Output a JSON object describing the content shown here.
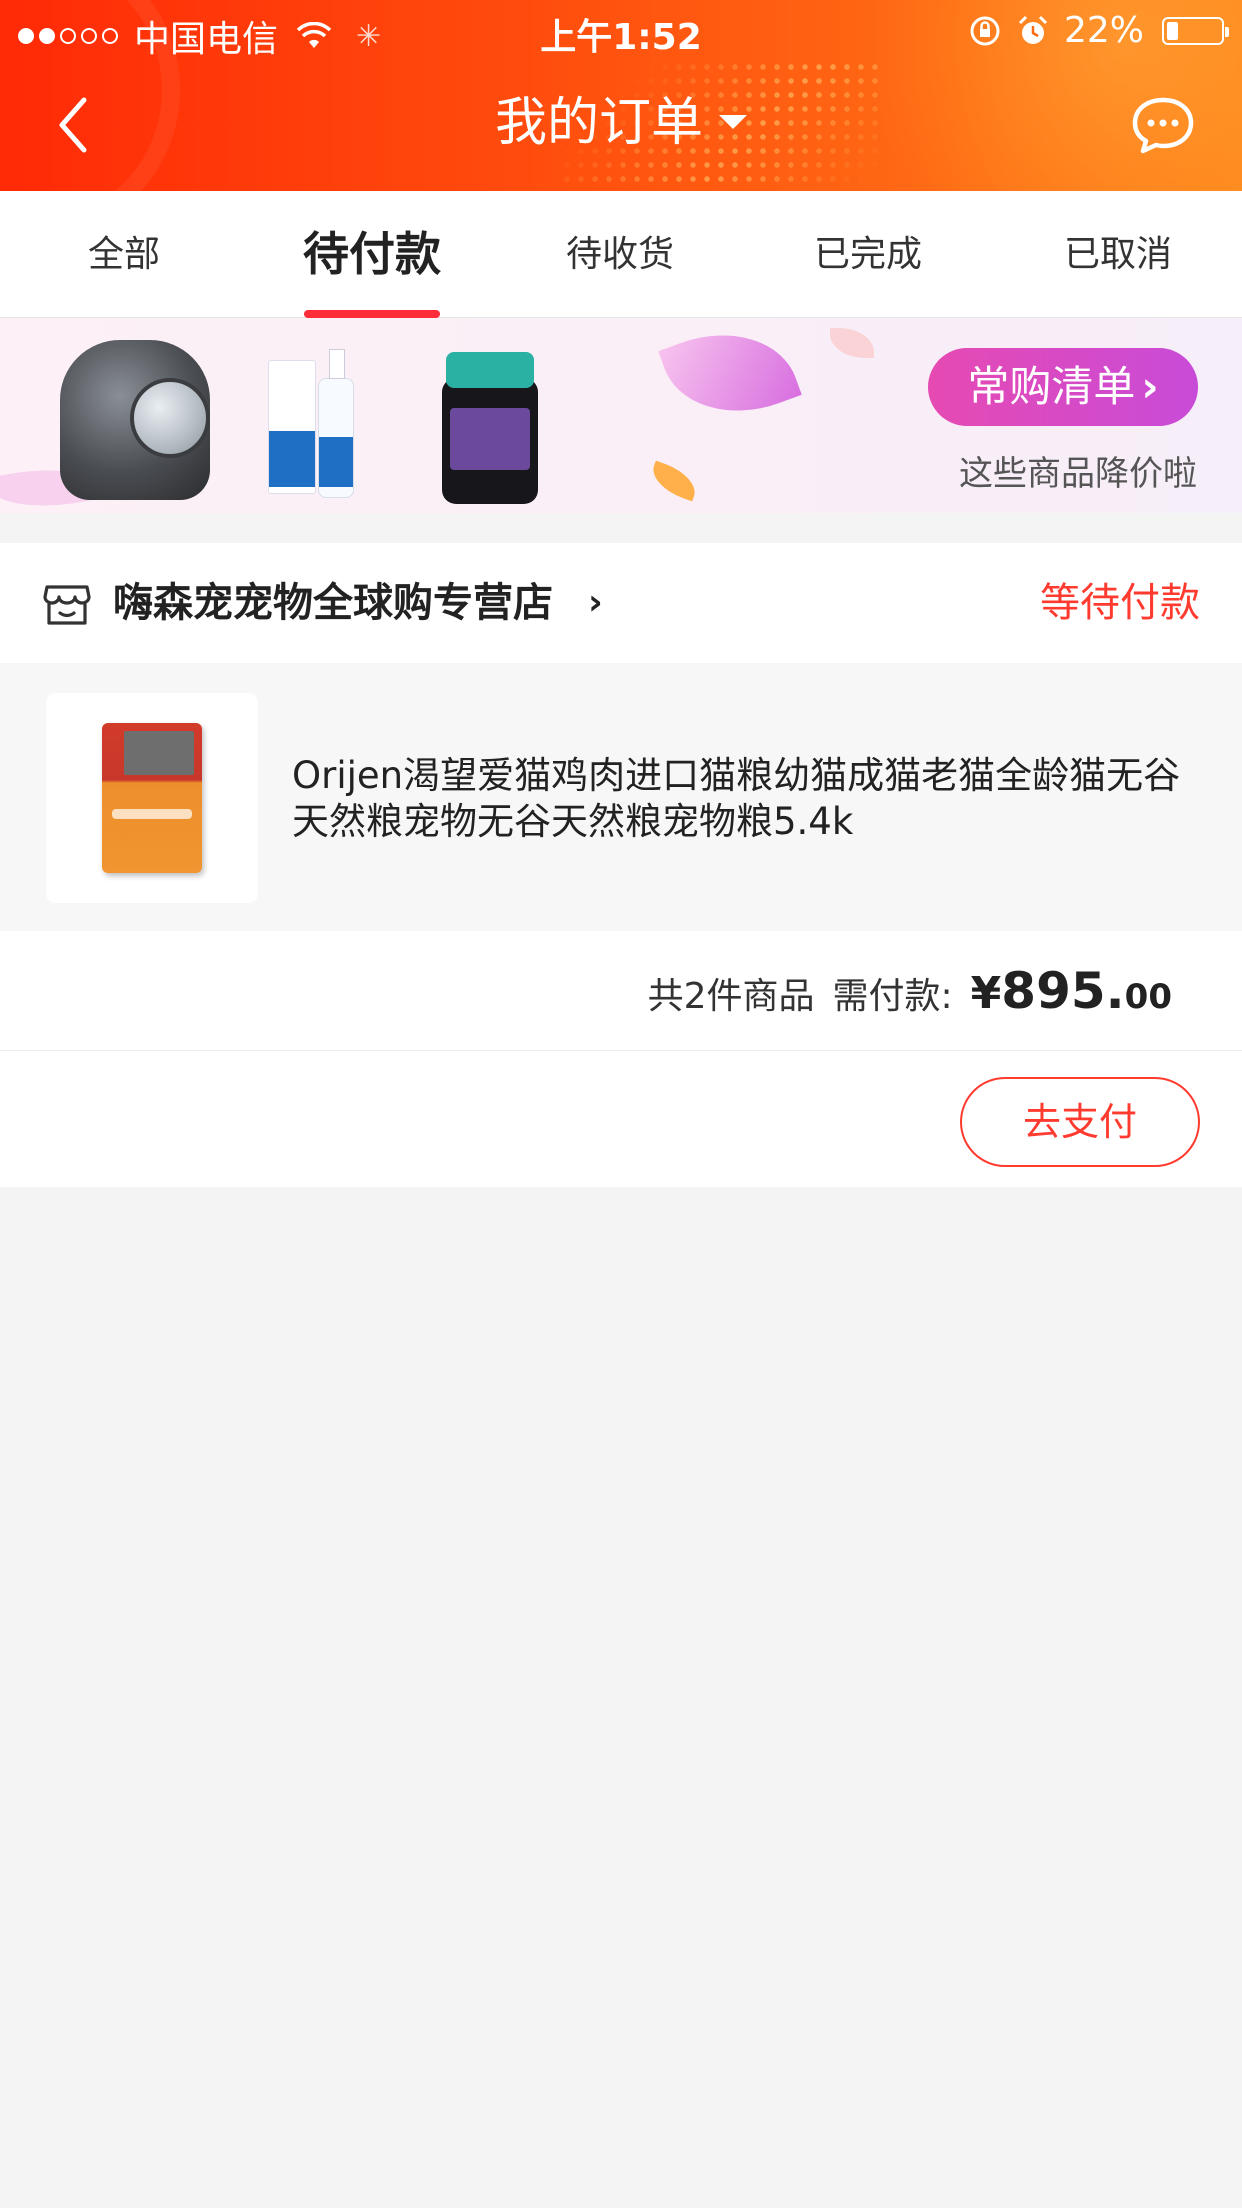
{
  "status_bar": {
    "carrier": "中国电信",
    "time": "上午1:52",
    "battery_percent": "22%",
    "battery_level": 0.22,
    "signal_bars_filled": 2,
    "signal_bars_total": 5
  },
  "nav": {
    "title": "我的订单",
    "back_icon": "chevron-left-icon",
    "message_icon": "chat-bubble-icon"
  },
  "tabs": [
    {
      "label": "全部",
      "active": false
    },
    {
      "label": "待付款",
      "active": true
    },
    {
      "label": "待收货",
      "active": false
    },
    {
      "label": "已完成",
      "active": false
    },
    {
      "label": "已取消",
      "active": false
    }
  ],
  "banner": {
    "button_label": "常购清单",
    "subtitle": "这些商品降价啦"
  },
  "order": {
    "store_name": "嗨森宠宠物全球购专营店",
    "status": "等待付款",
    "item_title": "Orijen渴望爱猫鸡肉进口猫粮幼猫成猫老猫全龄猫无谷天然粮宠物无谷天然粮宠物粮5.4k",
    "total_count": "共2件商品",
    "total_label": "需付款:",
    "price_symbol": "¥",
    "price_integer": "895.",
    "price_decimal": "00",
    "pay_button": "去支付"
  },
  "colors": {
    "header_start": "#ff2a06",
    "header_end": "#ff8a1e",
    "accent_red": "#ff3b30",
    "tab_indicator": "#ff2d3a",
    "banner_button": "#d64bc4"
  }
}
